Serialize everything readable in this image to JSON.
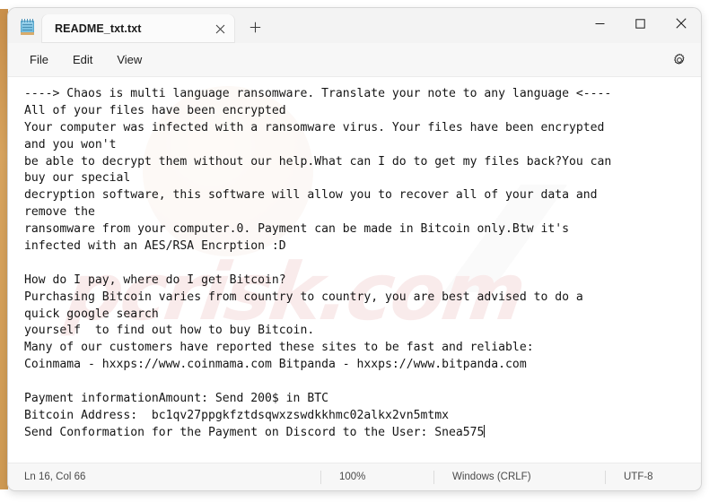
{
  "window": {
    "app_icon": "notepad-icon",
    "tab_title": "README_txt.txt",
    "tab_close_glyph": "✕",
    "new_tab_glyph": "＋",
    "controls": {
      "minimize": "minimize-icon",
      "maximize": "maximize-icon",
      "close": "close-icon"
    }
  },
  "menu": {
    "items": [
      {
        "label": "File"
      },
      {
        "label": "Edit"
      },
      {
        "label": "View"
      }
    ],
    "settings_icon": "gear-icon"
  },
  "editor": {
    "watermark_text": "pcrisk.com",
    "lines": [
      "----> Chaos is multi language ransomware. Translate your note to any language <----",
      "All of your files have been encrypted",
      "Your computer was infected with a ransomware virus. Your files have been encrypted and you won't",
      "be able to decrypt them without our help.What can I do to get my files back?You can buy our special",
      "decryption software, this software will allow you to recover all of your data and remove the",
      "ransomware from your computer.0. Payment can be made in Bitcoin only.Btw it's",
      "infected with an AES/RSA Encrption :D",
      "",
      "How do I pay, where do I get Bitcoin?",
      "Purchasing Bitcoin varies from country to country, you are best advised to do a quick google search",
      "yourself  to find out how to buy Bitcoin.",
      "Many of our customers have reported these sites to be fast and reliable:",
      "Coinmama - hxxps://www.coinmama.com Bitpanda - hxxps://www.bitpanda.com",
      "",
      "Payment informationAmount: Send 200$ in BTC",
      "Bitcoin Address:  bc1qv27ppgkfztdsqwxzswdkkhmc02alkx2vn5mtmx",
      "Send Conformation for the Payment on Discord to the User: Snea575"
    ],
    "wrapped_display_lines": [
      "----> Chaos is multi language ransomware. Translate your note to any language <----",
      "All of your files have been encrypted",
      "Your computer was infected with a ransomware virus. Your files have been encrypted",
      "and you won't",
      "be able to decrypt them without our help.What can I do to get my files back?You can",
      "buy our special",
      "decryption software, this software will allow you to recover all of your data and",
      "remove the",
      "ransomware from your computer.0. Payment can be made in Bitcoin only.Btw it's",
      "infected with an AES/RSA Encrption :D",
      "",
      "How do I pay, where do I get Bitcoin?",
      "Purchasing Bitcoin varies from country to country, you are best advised to do a",
      "quick google search",
      "yourself  to find out how to buy Bitcoin.",
      "Many of our customers have reported these sites to be fast and reliable:",
      "Coinmama - hxxps://www.coinmama.com Bitpanda - hxxps://www.bitpanda.com",
      "",
      "Payment informationAmount: Send 200$ in BTC",
      "Bitcoin Address:  bc1qv27ppgkfztdsqwxzswdkkhmc02alkx2vn5mtmx",
      "Send Conformation for the Payment on Discord to the User: Snea575"
    ]
  },
  "status_bar": {
    "position": "Ln 16, Col 66",
    "zoom": "100%",
    "line_endings": "Windows (CRLF)",
    "encoding": "UTF-8"
  },
  "colors": {
    "accent_red": "#d61f26",
    "window_bg": "#f3f3f3",
    "editor_bg": "#ffffff",
    "text": "#151515"
  }
}
